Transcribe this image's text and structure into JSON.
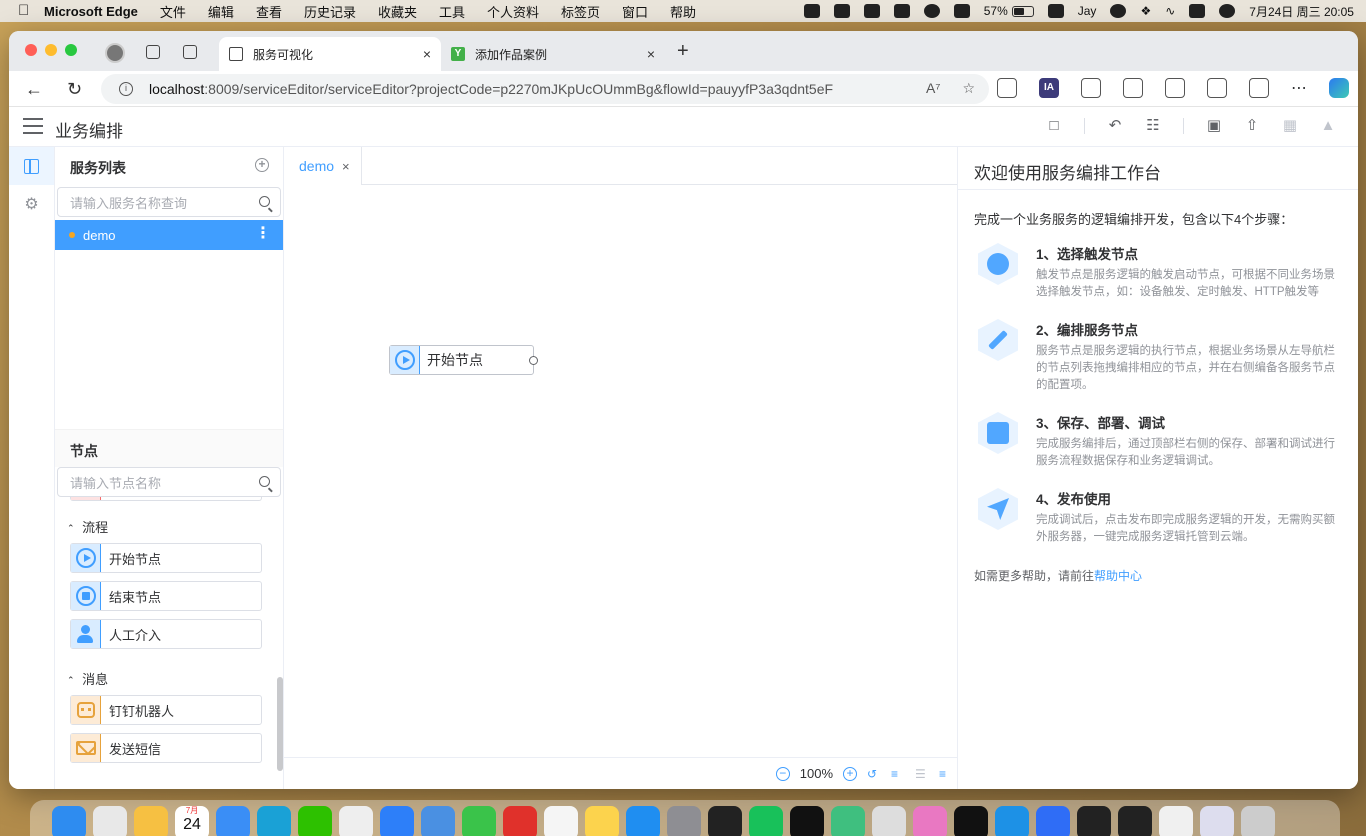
{
  "menubar": {
    "app": "Microsoft Edge",
    "items": [
      "文件",
      "编辑",
      "查看",
      "历史记录",
      "收藏夹",
      "工具",
      "个人资料",
      "标签页",
      "窗口",
      "帮助"
    ],
    "battery": "57%",
    "battery_level": 0.57,
    "user": "Jay",
    "datetime": "7月24日 周三  20:05"
  },
  "browser": {
    "tabs": [
      {
        "title": "服务可视化",
        "close": "×",
        "active": true
      },
      {
        "title": "添加作品案例",
        "close": "×",
        "active": false
      }
    ],
    "new_tab": "+",
    "url_host": "localhost",
    "url_rest": ":8009/serviceEditor/serviceEditor?projectCode=p2270mJKpUcOUmmBg&flowId=pauyyfP3a3qdnt5eF",
    "ext_ia": "IA"
  },
  "app": {
    "title": "业务编排"
  },
  "services": {
    "title": "服务列表",
    "search_placeholder": "请输入服务名称查询",
    "items": [
      {
        "name": "demo"
      }
    ]
  },
  "nodes": {
    "title": "节点",
    "search_placeholder": "请输入节点名称",
    "groups": [
      {
        "name": "流程",
        "items": [
          "开始节点",
          "结束节点",
          "人工介入"
        ]
      },
      {
        "name": "消息",
        "items": [
          "钉钉机器人",
          "发送短信"
        ]
      }
    ]
  },
  "canvas": {
    "tab": "demo",
    "tab_close": "×",
    "node_label": "开始节点",
    "zoom": "100%"
  },
  "welcome": {
    "title": "欢迎使用服务编排工作台",
    "intro": "完成一个业务服务的逻辑编排开发，包含以下4个步骤：",
    "steps": [
      {
        "title": "1、选择触发节点",
        "desc": "触发节点是服务逻辑的触发启动节点，可根据不同业务场景选择触发节点，如：设备触发、定时触发、HTTP触发等"
      },
      {
        "title": "2、编排服务节点",
        "desc": "服务节点是服务逻辑的执行节点，根据业务场景从左导航栏的节点列表拖拽编排相应的节点，并在右侧编备各服务节点的配置项。"
      },
      {
        "title": "3、保存、部署、调试",
        "desc": "完成服务编排后，通过顶部栏右侧的保存、部署和调试进行服务流程数据保存和业务逻辑调试。"
      },
      {
        "title": "4、发布使用",
        "desc": "完成调试后，点击发布即完成服务逻辑的开发，无需购买额外服务器，一键完成服务逻辑托管到云端。"
      }
    ],
    "help_prefix": "如需更多帮助，请前往",
    "help_link": "帮助中心"
  },
  "dock": {
    "calendar_month": "7月",
    "calendar_day": "24"
  },
  "colors": {
    "primary": "#409eff",
    "warning": "#e6a23c"
  }
}
